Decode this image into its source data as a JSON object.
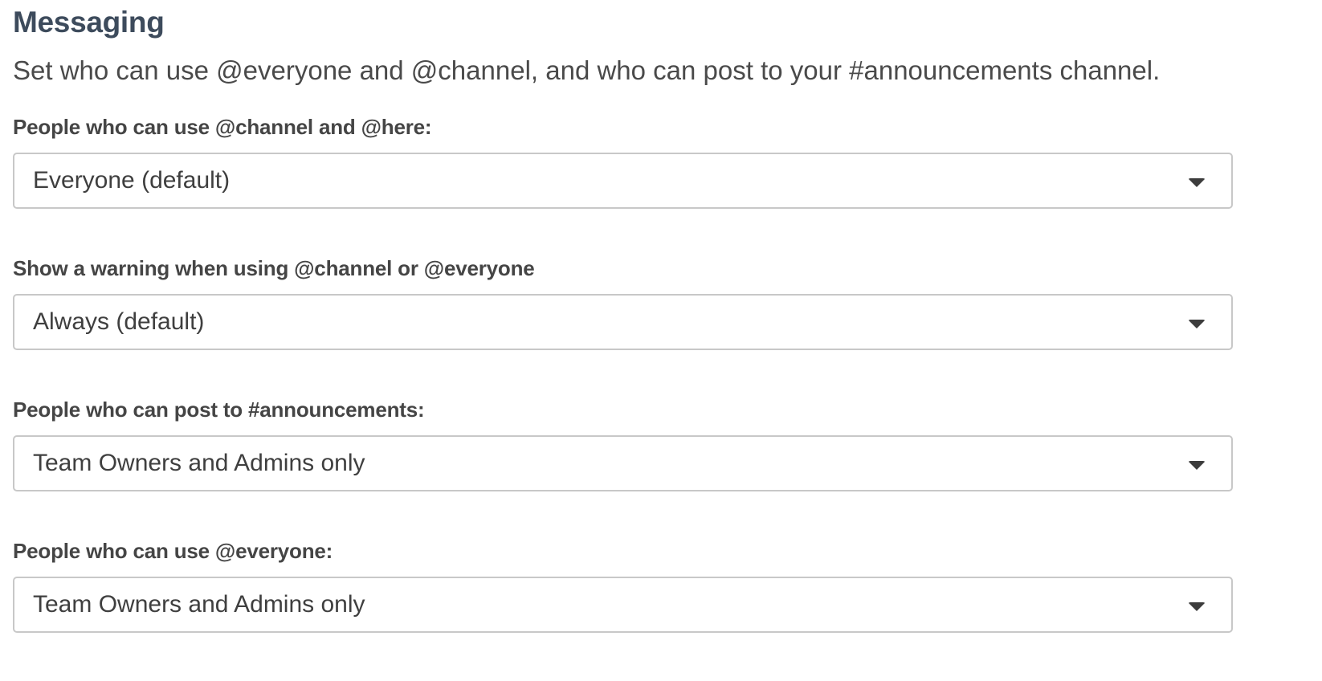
{
  "section": {
    "title": "Messaging",
    "description": "Set who can use @everyone and @channel, and who can post to your #announcements channel."
  },
  "fields": [
    {
      "label": "People who can use @channel and @here:",
      "selected": "Everyone (default)",
      "icon": "chevron-down-icon"
    },
    {
      "label": "Show a warning when using @channel or @everyone",
      "selected": "Always (default)",
      "icon": "chevron-down-icon"
    },
    {
      "label": "People who can post to #announcements:",
      "selected": "Team Owners and Admins only",
      "icon": "chevron-down-icon"
    },
    {
      "label": "People who can use @everyone:",
      "selected": "Team Owners and Admins only",
      "icon": "chevron-down-icon"
    }
  ],
  "colors": {
    "title": "#3d4b5c",
    "text": "#454545",
    "border": "#c8c8c8",
    "background": "#ffffff"
  }
}
